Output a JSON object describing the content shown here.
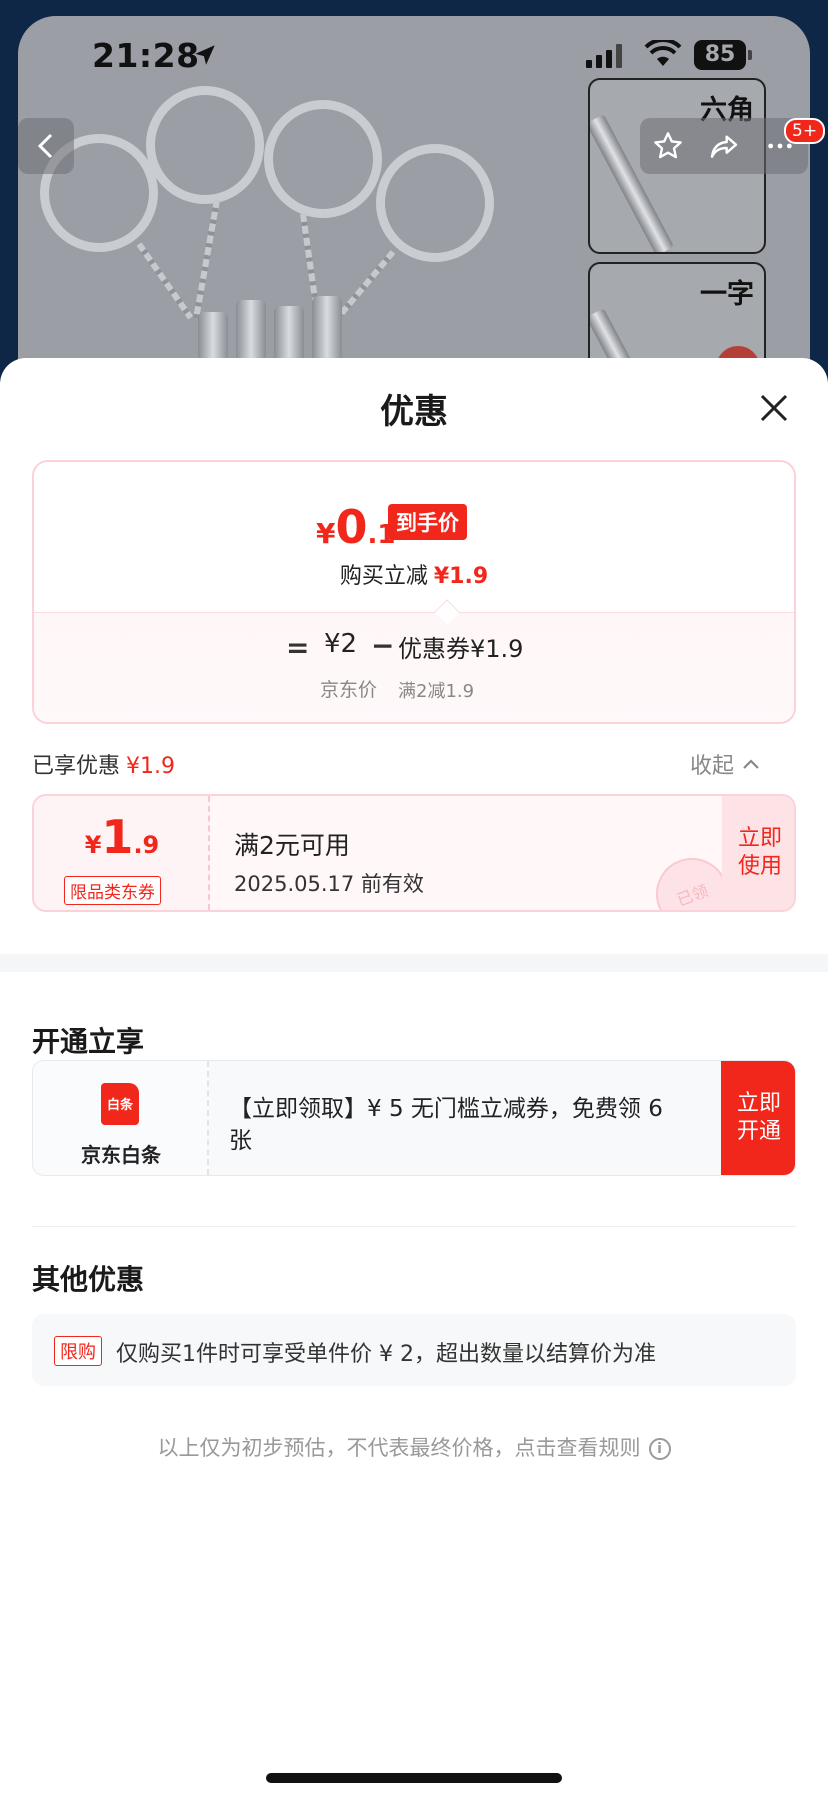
{
  "status_bar": {
    "time": "21:28",
    "battery": "85"
  },
  "product_bg": {
    "thumb1_label": "六角",
    "thumb2_label": "一字",
    "badge": "5+"
  },
  "sheet": {
    "title": "优惠",
    "price_card": {
      "final_currency": "¥",
      "final_int": "0",
      "final_dec": ".1",
      "final_tag": "到手价",
      "reduce_label": "购买立减",
      "reduce_value": "¥1.9",
      "equals": "=",
      "jd_price": "¥2",
      "jd_price_label": "京东价",
      "minus": "−",
      "coupon_amount": "优惠券¥1.9",
      "coupon_condition": "满2减1.9"
    },
    "enjoyed": {
      "label": "已享优惠",
      "value": "¥1.9",
      "collapse": "收起"
    },
    "coupon": {
      "currency": "¥",
      "int": "1",
      "dec": ".9",
      "tag": "限品类东券",
      "title": "满2元可用",
      "valid": "2025.05.17 前有效",
      "action": "立即使用",
      "stamp": "已领"
    },
    "open_section": {
      "title": "开通立享",
      "logo_text": "白条",
      "name": "京东白条",
      "text": "【立即领取】¥ 5 无门槛立减券，免费领 6 张",
      "action": "立即开通"
    },
    "other_section": {
      "title": "其他优惠",
      "tag": "限购",
      "text": "仅购买1件时可享受单件价 ¥ 2，超出数量以结算价为准"
    },
    "note": "以上仅为初步预估，不代表最终价格，点击查看规则",
    "note_icon": "i"
  },
  "colors": {
    "accent": "#f2271c",
    "pink_border": "#fad2d8",
    "muted": "#999999"
  }
}
